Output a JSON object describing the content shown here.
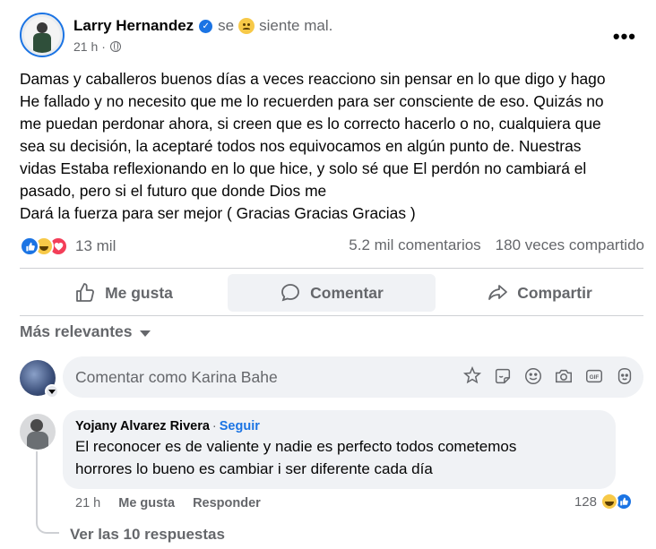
{
  "post": {
    "author": "Larry Hernandez",
    "feeling_prefix": "se",
    "feeling_text": "siente mal.",
    "time": "21 h",
    "text_lines": [
      "Damas y caballeros buenos días a veces reacciono sin pensar en lo que digo y hago",
      "He fallado y no necesito que me lo recuerden para ser consciente de eso. Quizás no",
      "me puedan perdonar ahora, si creen que es lo correcto hacerlo o no, cualquiera que",
      "sea su decisión, la aceptaré  todos nos equivocamos en algún punto de. Nuestras",
      "vidas Estaba reflexionando en lo que hice, y solo sé que El perdón no cambiará el",
      "pasado, pero si el futuro que donde Dios me",
      "Dará la fuerza para ser mejor ( Gracias Gracias Gracias )"
    ],
    "reaction_count": "13 mil",
    "comments_count": "5.2 mil comentarios",
    "shares_count": "180 veces compartido"
  },
  "actions": {
    "like": "Me gusta",
    "comment": "Comentar",
    "share": "Compartir"
  },
  "sort_label": "Más relevantes",
  "composer": {
    "placeholder": "Comentar como Karina Bahe"
  },
  "comment": {
    "author": "Yojany Alvarez Rivera",
    "separator": "·",
    "follow": "Seguir",
    "text_lines": [
      "El reconocer es de valiente y nadie es perfecto todos cometemos",
      "horrores lo bueno es cambiar i ser diferente cada día"
    ],
    "time": "21 h",
    "like": "Me gusta",
    "reply": "Responder",
    "reaction_count": "128"
  },
  "view_replies": "Ver las 10 respuestas",
  "colors": {
    "accent": "#1b74e4",
    "secondary_text": "#65676b",
    "bubble": "#f0f2f5"
  },
  "icons": [
    "verified-icon",
    "feeling-emoji-icon",
    "globe-icon",
    "more-icon",
    "like-icon",
    "comment-icon",
    "share-icon",
    "caret-down-icon",
    "avatar-icon",
    "sticker-icon",
    "emoji-icon",
    "camera-icon",
    "gif-icon"
  ]
}
